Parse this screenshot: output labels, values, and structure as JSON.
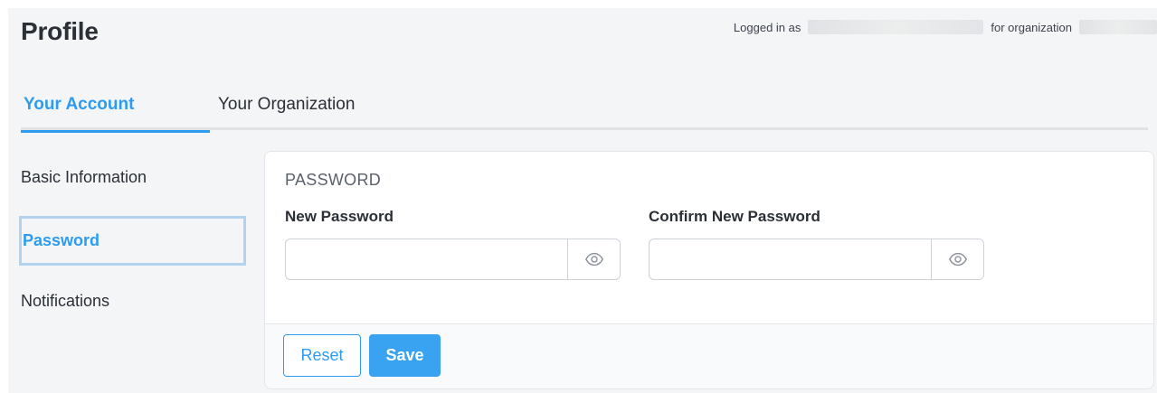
{
  "header": {
    "title": "Profile",
    "logged_in_prefix": "Logged in as",
    "org_prefix": "for organization"
  },
  "tabs": [
    {
      "label": "Your Account",
      "active": true
    },
    {
      "label": "Your Organization",
      "active": false
    }
  ],
  "sidebar": {
    "items": [
      {
        "label": "Basic Information",
        "active": false
      },
      {
        "label": "Password",
        "active": true
      },
      {
        "label": "Notifications",
        "active": false
      }
    ]
  },
  "password_form": {
    "section_title": "PASSWORD",
    "new_password": {
      "label": "New Password",
      "value": "",
      "placeholder": ""
    },
    "confirm_password": {
      "label": "Confirm New Password",
      "value": "",
      "placeholder": ""
    },
    "toggle_icon": "eye-icon"
  },
  "actions": {
    "reset_label": "Reset",
    "save_label": "Save"
  },
  "colors": {
    "accent": "#2d9cf0",
    "save_bg": "#39a3f2",
    "page_bg": "#f4f5f7",
    "text_dark": "#2b2f36"
  }
}
